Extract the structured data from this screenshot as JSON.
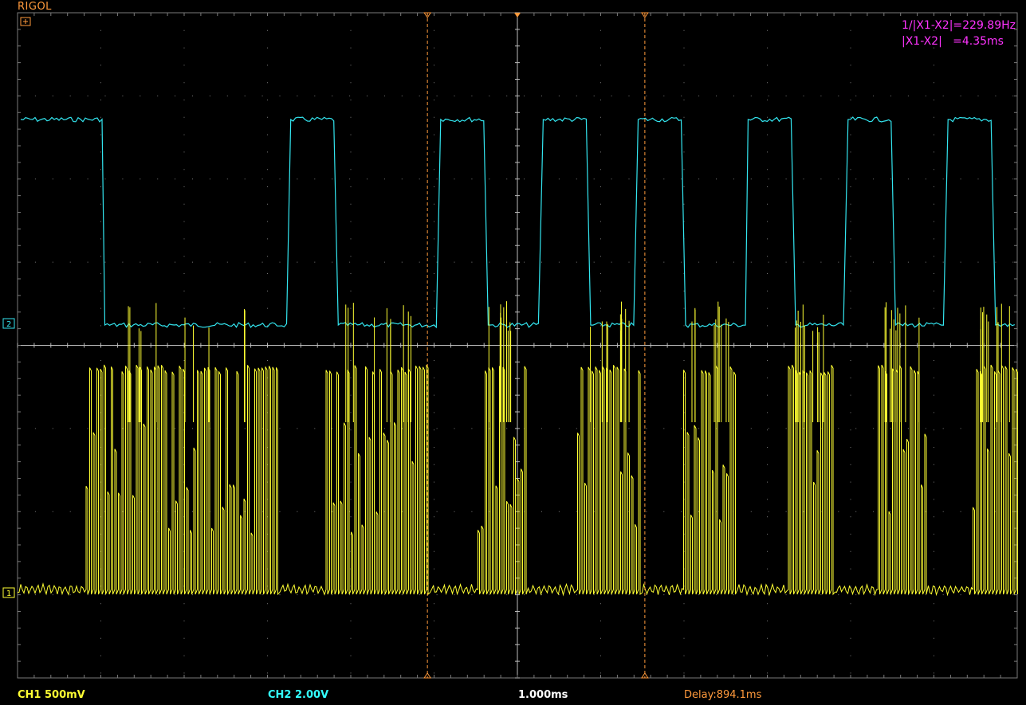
{
  "brand": "RIGOL",
  "cursor": {
    "freq_label": "1/|X1-X2|=229.89Hz",
    "delta_label": "|X1-X2|   =4.35ms"
  },
  "status": {
    "ch1": "CH1 500mV",
    "ch2": "CH2 2.00V",
    "timebase": "1.000ms",
    "delay": "Delay:894.1ms"
  },
  "markers": {
    "ch1": "1",
    "ch2": "2"
  },
  "colors": {
    "ch1": "#ffff33",
    "ch2": "#33e6f0",
    "cursor": "#ff9a3c",
    "readout": "#ff33ff",
    "grid": "#7a7a7a"
  },
  "ch2_segments": [
    {
      "state": "high",
      "t0": 0.0,
      "t1": 1.73
    },
    {
      "state": "low",
      "t0": 1.73,
      "t1": 5.45
    },
    {
      "state": "high",
      "t0": 5.45,
      "t1": 6.4
    },
    {
      "state": "low",
      "t0": 6.4,
      "t1": 8.45
    },
    {
      "state": "high",
      "t0": 8.45,
      "t1": 9.4
    },
    {
      "state": "low",
      "t0": 9.4,
      "t1": 10.5
    },
    {
      "state": "high",
      "t0": 10.5,
      "t1": 11.45
    },
    {
      "state": "low",
      "t0": 11.45,
      "t1": 12.4
    },
    {
      "state": "high",
      "t0": 12.4,
      "t1": 13.35
    },
    {
      "state": "low",
      "t0": 13.35,
      "t1": 14.6
    },
    {
      "state": "high",
      "t0": 14.6,
      "t1": 15.55
    },
    {
      "state": "low",
      "t0": 15.55,
      "t1": 16.6
    },
    {
      "state": "high",
      "t0": 16.6,
      "t1": 17.55
    },
    {
      "state": "low",
      "t0": 17.55,
      "t1": 18.6
    },
    {
      "state": "high",
      "t0": 18.6,
      "t1": 19.55
    },
    {
      "state": "low",
      "t0": 19.55,
      "t1": 20.0
    }
  ],
  "ch1_bursts": [
    {
      "t0": 1.35,
      "t1": 5.2
    },
    {
      "t0": 6.15,
      "t1": 8.2
    },
    {
      "t0": 9.2,
      "t1": 10.15
    },
    {
      "t0": 11.2,
      "t1": 12.45
    },
    {
      "t0": 13.3,
      "t1": 14.4
    },
    {
      "t0": 15.4,
      "t1": 16.35
    },
    {
      "t0": 17.2,
      "t1": 18.2
    },
    {
      "t0": 19.1,
      "t1": 20.0
    }
  ],
  "cursors_t": [
    8.2,
    12.55
  ]
}
